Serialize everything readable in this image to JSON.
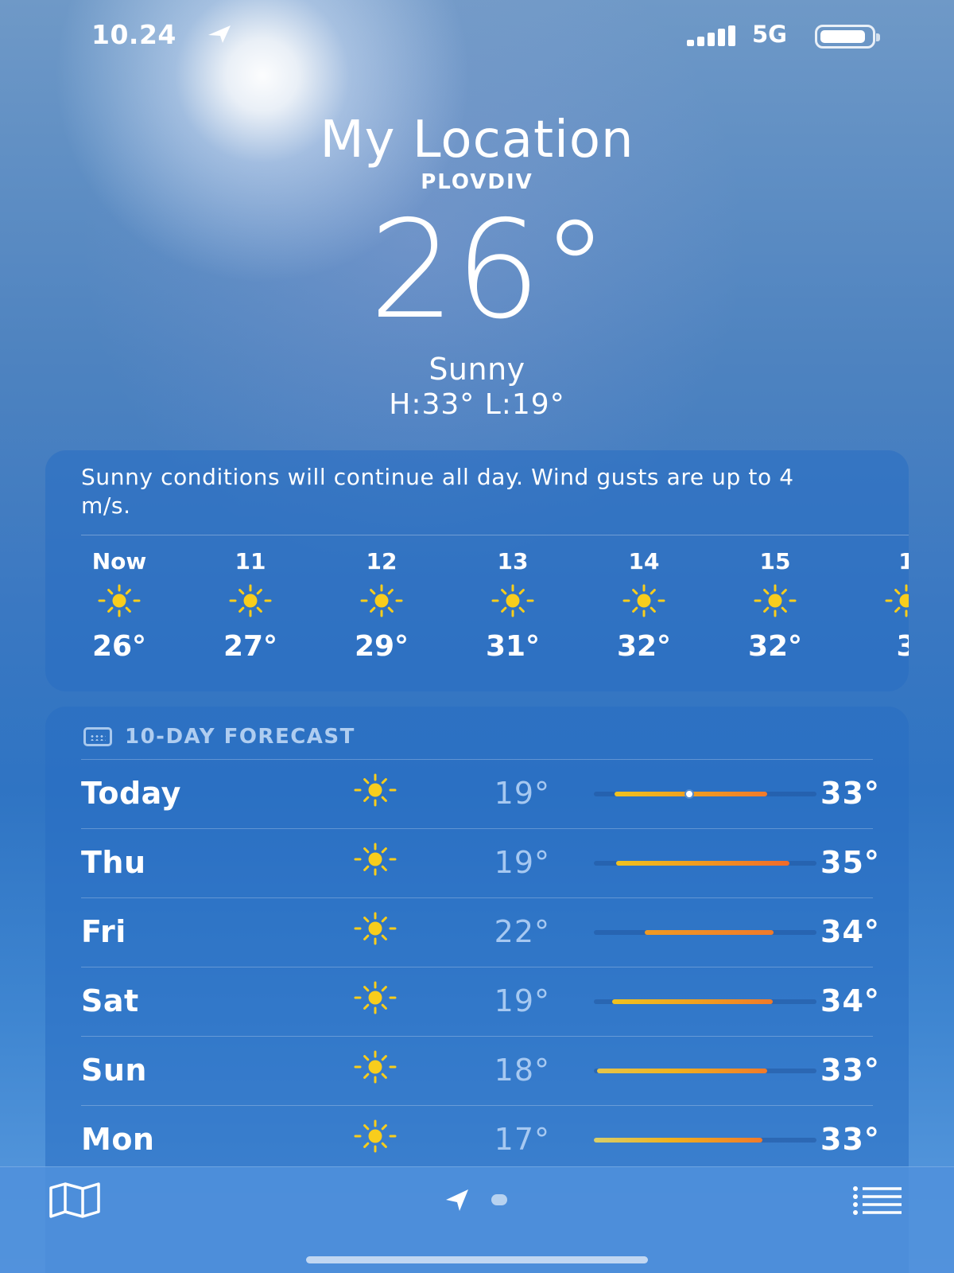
{
  "status_bar": {
    "time": "10.24",
    "network": "5G"
  },
  "header": {
    "title": "My Location",
    "subtitle": "PLOVDIV",
    "temperature": "26°",
    "condition": "Sunny",
    "hilo": "H:33°  L:19°"
  },
  "hourly": {
    "summary": "Sunny conditions will continue all day. Wind gusts are up to 4 m/s.",
    "items": [
      {
        "label": "Now",
        "icon": "sun-icon",
        "temp": "26°"
      },
      {
        "label": "11",
        "icon": "sun-icon",
        "temp": "27°"
      },
      {
        "label": "12",
        "icon": "sun-icon",
        "temp": "29°"
      },
      {
        "label": "13",
        "icon": "sun-icon",
        "temp": "31°"
      },
      {
        "label": "14",
        "icon": "sun-icon",
        "temp": "32°"
      },
      {
        "label": "15",
        "icon": "sun-icon",
        "temp": "32°"
      },
      {
        "label": "1",
        "icon": "sun-icon",
        "temp": "3"
      }
    ]
  },
  "forecast": {
    "title": "10-DAY FORECAST",
    "days": [
      {
        "name": "Today",
        "icon": "sun-icon",
        "low": "19°",
        "high": "33°"
      },
      {
        "name": "Thu",
        "icon": "sun-icon",
        "low": "19°",
        "high": "35°"
      },
      {
        "name": "Fri",
        "icon": "sun-icon",
        "low": "22°",
        "high": "34°"
      },
      {
        "name": "Sat",
        "icon": "sun-icon",
        "low": "19°",
        "high": "34°"
      },
      {
        "name": "Sun",
        "icon": "sun-icon",
        "low": "18°",
        "high": "33°"
      },
      {
        "name": "Mon",
        "icon": "sun-icon",
        "low": "17°",
        "high": "33°"
      }
    ]
  },
  "colors": {
    "sun": "#f8cd1c",
    "bar_warm": "#f0b21f",
    "bar_hot": "#f07a2a"
  }
}
